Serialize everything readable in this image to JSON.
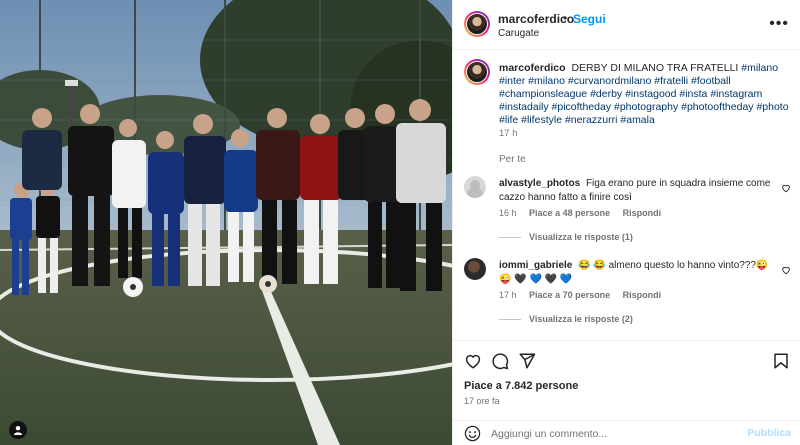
{
  "post": {
    "username": "marcoferdico",
    "follow_label": "Segui",
    "location": "Carugate",
    "more_glyph": "•••"
  },
  "caption": {
    "username": "marcoferdico",
    "text": "DERBY DI MILANO TRA FRATELLI",
    "hashtags": "#milano #inter #milano #curvanordmilano #fratelli #football #championsleague #derby #instagood #insta #instagram #instadaily #picoftheday #photography #photooftheday #photo #life #lifestyle #nerazzurri #amala",
    "time": "17 h"
  },
  "translate_label": "Per te",
  "comments": [
    {
      "username": "alvastyle_photos",
      "text": "Figa erano pure in squadra insieme come cazzo hanno fatto a finire così",
      "time": "16 h",
      "likes": "Piace a 48 persone",
      "reply_label": "Rispondi",
      "replies_label": "Visualizza le risposte (1)"
    },
    {
      "username": "iommi_gabriele",
      "text": "😂 😂 almeno questo lo hanno vinto???😜 😜 🖤 💙 🖤 💙",
      "time": "17 h",
      "likes": "Piace a 70 persone",
      "reply_label": "Rispondi",
      "replies_label": "Visualizza le risposte (2)"
    }
  ],
  "likes_count": "Piace a 7.842 persone",
  "post_time": "17 ore fa",
  "comment_box": {
    "placeholder": "Aggiungi un commento...",
    "publish_label": "Pubblica"
  },
  "icons": {
    "like": "heart-outline-icon",
    "comment": "speech-bubble-icon",
    "share": "paper-plane-icon",
    "save": "bookmark-icon",
    "emoji": "smiley-icon",
    "tag": "user-tag-icon"
  },
  "colors": {
    "accent": "#0095f6",
    "link": "#00376b",
    "secondary_text": "#737373",
    "publish_disabled": "#b2dffc"
  }
}
